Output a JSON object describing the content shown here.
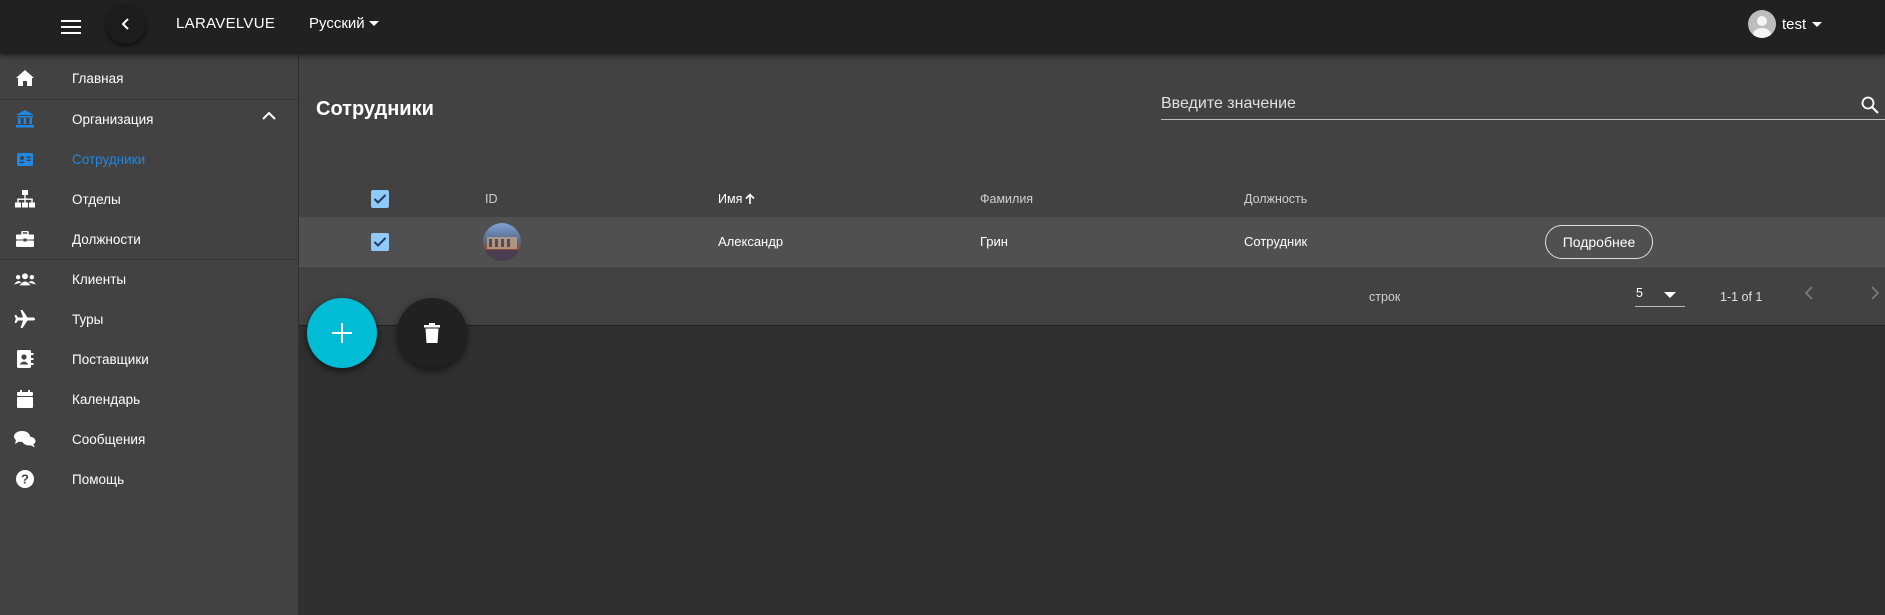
{
  "app": {
    "title": "LARAVELVUE",
    "language": "Русский",
    "user": "test"
  },
  "sidebar": {
    "items": [
      {
        "label": "Главная",
        "icon": "home-icon"
      },
      {
        "label": "Организация",
        "icon": "bank-icon",
        "expanded": true
      },
      {
        "label": "Сотрудники",
        "icon": "contact-card-icon",
        "active": true
      },
      {
        "label": "Отделы",
        "icon": "org-chart-icon"
      },
      {
        "label": "Должности",
        "icon": "briefcase-icon"
      },
      {
        "label": "Клиенты",
        "icon": "users-icon"
      },
      {
        "label": "Туры",
        "icon": "airplane-icon"
      },
      {
        "label": "Поставщики",
        "icon": "address-book-icon"
      },
      {
        "label": "Календарь",
        "icon": "calendar-icon"
      },
      {
        "label": "Сообщения",
        "icon": "chat-icon"
      },
      {
        "label": "Помощь",
        "icon": "help-icon"
      }
    ]
  },
  "page": {
    "title": "Сотрудники",
    "search_placeholder": "Введите значение"
  },
  "table": {
    "headers": {
      "id": "ID",
      "name": "Имя",
      "surname": "Фамилия",
      "position": "Должность"
    },
    "sorted_by": "name",
    "sort_direction": "asc",
    "rows": [
      {
        "selected": true,
        "name": "Александр",
        "surname": "Грин",
        "position": "Сотрудник",
        "action": "Подробнее"
      }
    ],
    "select_all": true
  },
  "pagination": {
    "rows_label": "строк",
    "rows_per_page": "5",
    "range": "1-1 of 1"
  },
  "colors": {
    "accent": "#1e88e5",
    "fab": "#00bcd4",
    "checkbox": "#90caf9"
  }
}
